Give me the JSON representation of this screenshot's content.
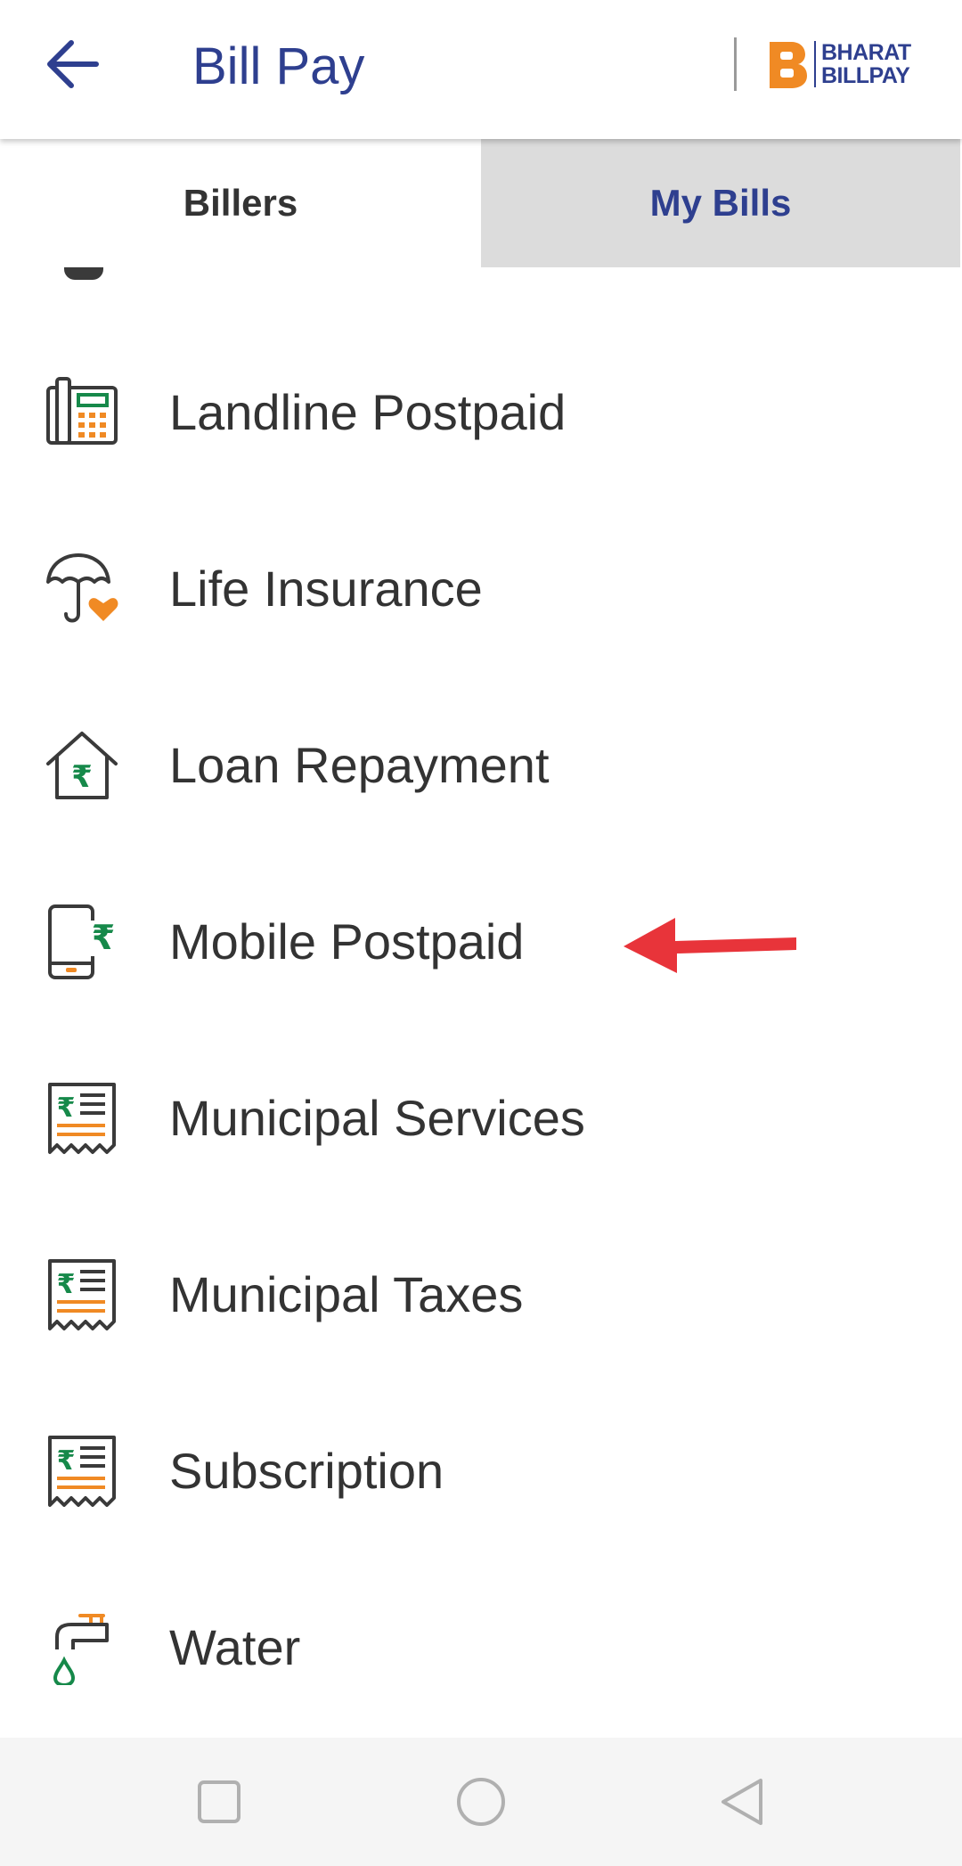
{
  "header": {
    "title": "Bill Pay",
    "logo_line1": "BHARAT",
    "logo_line2": "BILLPAY",
    "accent_color": "#2e3f8f",
    "logo_orange": "#f08a24"
  },
  "tabs": [
    {
      "label": "Billers",
      "selected": true
    },
    {
      "label": "My Bills",
      "selected": false
    }
  ],
  "billers": [
    {
      "label": "Landline Postpaid",
      "icon": "landline-phone-icon"
    },
    {
      "label": "Life Insurance",
      "icon": "umbrella-heart-icon"
    },
    {
      "label": "Loan Repayment",
      "icon": "house-rupee-icon"
    },
    {
      "label": "Mobile Postpaid",
      "icon": "mobile-rupee-icon"
    },
    {
      "label": "Municipal Services",
      "icon": "rupee-receipt-icon"
    },
    {
      "label": "Municipal Taxes",
      "icon": "rupee-receipt-icon"
    },
    {
      "label": "Subscription",
      "icon": "rupee-receipt-icon"
    },
    {
      "label": "Water",
      "icon": "water-tap-icon"
    }
  ],
  "annotation": {
    "color": "#e8343a",
    "icon": "red-arrow-annotation"
  },
  "navbar": {
    "icons": [
      "recent-apps-icon",
      "home-icon",
      "back-nav-icon"
    ]
  }
}
